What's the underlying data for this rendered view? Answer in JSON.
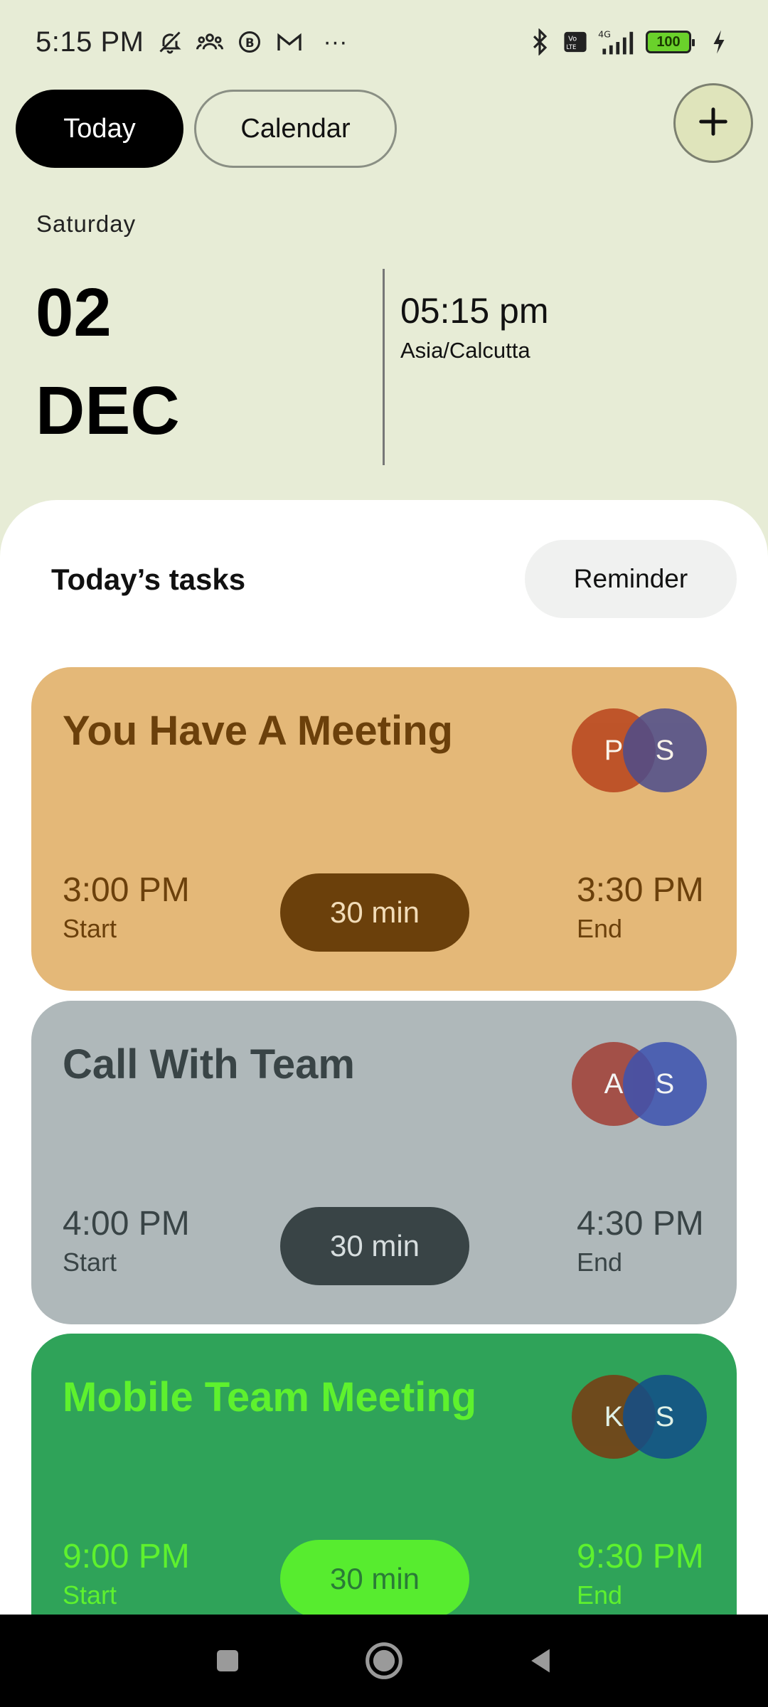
{
  "status_bar": {
    "time": "5:15 PM",
    "more": "···",
    "battery": "100"
  },
  "tabs": {
    "today": "Today",
    "calendar": "Calendar"
  },
  "date": {
    "weekday": "Saturday",
    "day": "02",
    "month": "DEC",
    "time": "05:15 pm",
    "timezone": "Asia/Calcutta"
  },
  "tasks_section": {
    "title": "Today’s tasks",
    "reminder_label": "Reminder"
  },
  "tasks": [
    {
      "title": "You Have A Meeting",
      "avatars": [
        "P",
        "S"
      ],
      "start": "3:00 PM",
      "start_label": "Start",
      "duration": "30 min",
      "end": "3:30 PM",
      "end_label": "End",
      "colors": {
        "card": "#e4b878",
        "text": "#6b400b",
        "pill": "#6b400b",
        "pill_text": "#f2dcb8",
        "avatar1": "#b8431c",
        "avatar2": "#4c4c8c"
      }
    },
    {
      "title": "Call With Team",
      "avatars": [
        "A",
        "S"
      ],
      "start": "4:00 PM",
      "start_label": "Start",
      "duration": "30 min",
      "end": "4:30 PM",
      "end_label": "End",
      "colors": {
        "card": "#afb8ba",
        "text": "#394446",
        "pill": "#394446",
        "pill_text": "#d7dedf",
        "avatar1": "#a23e35",
        "avatar2": "#3d52b0"
      }
    },
    {
      "title": "Mobile Team Meeting",
      "avatars": [
        "K",
        "S"
      ],
      "start": "9:00 PM",
      "start_label": "Start",
      "duration": "30 min",
      "end": "9:30 PM",
      "end_label": "End",
      "colors": {
        "card": "#2fa359",
        "text": "#5ef12e",
        "pill": "#57ec2f",
        "pill_text": "#2a7b37",
        "avatar1": "#7a3b12",
        "avatar2": "#124e8a"
      }
    }
  ]
}
